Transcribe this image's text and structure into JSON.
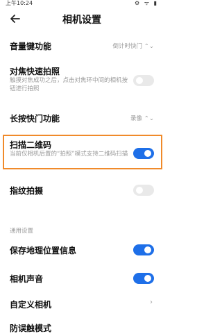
{
  "status": {
    "time": "上午10:24",
    "icons_text": "⚙ ᯤ ▮"
  },
  "header": {
    "title": "相机设置"
  },
  "settings": [
    {
      "label": "音量键功能",
      "value": "倒计时快门 ⌃⌄"
    },
    {
      "label": "对焦快速拍照",
      "desc": "触摸对焦成功之后，点击对焦环中间的相机按钮进行拍照",
      "toggle": "off"
    },
    {
      "label": "长按快门功能",
      "value": "录像 ⌃⌄"
    },
    {
      "label": "扫描二维码",
      "desc": "当前仅相机后置的“拍照”模式支持二维码扫描",
      "toggle": "on"
    },
    {
      "label": "指纹拍摄",
      "toggle": "off"
    }
  ],
  "section_general": "通用设置",
  "general": [
    {
      "label": "保存地理位置信息",
      "toggle": "on"
    },
    {
      "label": "相机声音",
      "toggle": "on"
    },
    {
      "label": "自定义相机",
      "chevron": "›"
    },
    {
      "label": "防误触模式"
    }
  ],
  "colors": {
    "accent": "#1e6fe8",
    "highlight": "#f08a2a"
  }
}
